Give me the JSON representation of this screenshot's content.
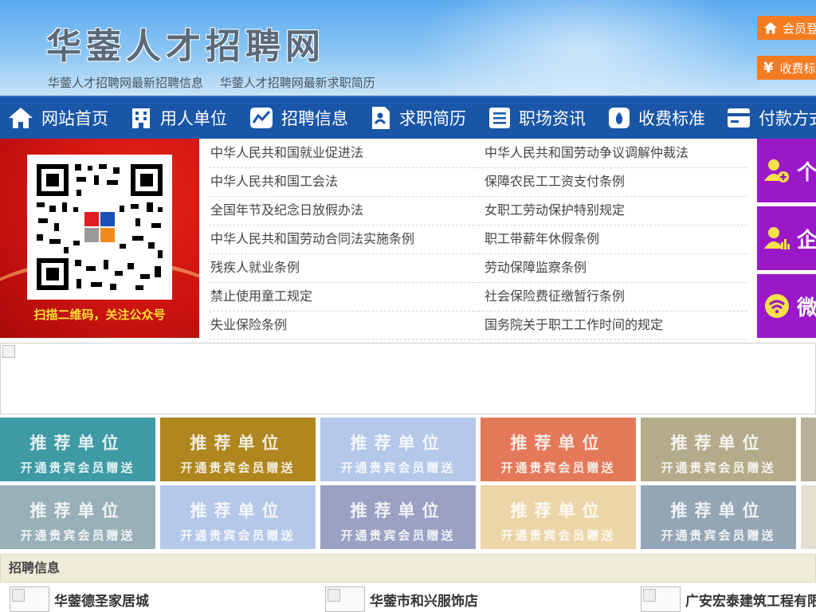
{
  "header": {
    "site_title": "华蓥人才招聘网",
    "links": [
      "华蓥人才招聘网最新招聘信息",
      "华蓥人才招聘网最新求职简历"
    ],
    "login_button": "会员登",
    "fee_button": "收费标"
  },
  "nav": [
    {
      "label": "网站首页",
      "icon": "home-icon"
    },
    {
      "label": "用人单位",
      "icon": "building-icon"
    },
    {
      "label": "招聘信息",
      "icon": "chart-icon"
    },
    {
      "label": "求职简历",
      "icon": "resume-icon"
    },
    {
      "label": "职场资讯",
      "icon": "news-icon"
    },
    {
      "label": "收费标准",
      "icon": "moneybag-icon"
    },
    {
      "label": "付款方式",
      "icon": "card-icon"
    }
  ],
  "qr": {
    "caption": "扫描二维码，关注公众号"
  },
  "laws": [
    [
      "中华人民共和国就业促进法",
      "中华人民共和国劳动争议调解仲裁法"
    ],
    [
      "中华人民共和国工会法",
      "保障农民工工资支付条例"
    ],
    [
      "全国年节及纪念日放假办法",
      "女职工劳动保护特别规定"
    ],
    [
      "中华人民共和国劳动合同法实施条例",
      "职工带薪年休假条例"
    ],
    [
      "残疾人就业条例",
      "劳动保障监察条例"
    ],
    [
      "禁止使用童工规定",
      "社会保险费征缴暂行条例"
    ],
    [
      "失业保险条例",
      "国务院关于职工工作时间的规定"
    ]
  ],
  "side_buttons": [
    {
      "label": "个",
      "icon": "user-add-icon"
    },
    {
      "label": "企",
      "icon": "enterprise-icon"
    },
    {
      "label": "微",
      "icon": "wechat-icon"
    }
  ],
  "tiles": {
    "line1": "推荐单位",
    "line2": "开通贵宾会员赠送",
    "row1_colors": [
      "#3e9aa5",
      "#b0861f",
      "#b4c8ea",
      "#e4795a",
      "#b4ab8b",
      "#b9b099"
    ],
    "row2_colors": [
      "#98b0b8",
      "#b4c8ea",
      "#9aa1c3",
      "#ecd6a8",
      "#94a6b6",
      "#e6dfd0"
    ]
  },
  "jobs": {
    "section_title": "招聘信息",
    "items": [
      "华蓥德圣家居城",
      "华蓥市和兴服饰店",
      "广安宏泰建筑工程有限公司"
    ]
  }
}
